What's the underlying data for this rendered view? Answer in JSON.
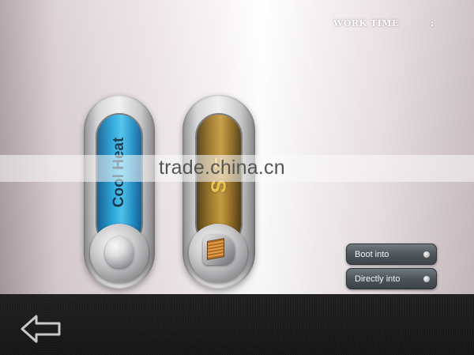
{
  "header": {
    "work_time_label": "WORK TIME",
    "work_time_separator": ":"
  },
  "handles": [
    {
      "label": "Cool Heat",
      "accent": "#23a6dc",
      "icon": "round-knob-icon"
    },
    {
      "label": "S =",
      "accent": "#c69a3a",
      "icon": "square-tip-probe-icon"
    }
  ],
  "buttons": {
    "boot_into": "Boot into",
    "directly_into": "Directly into"
  },
  "nav": {
    "back_icon": "back-arrow-icon"
  },
  "watermark": "trade.china.cn"
}
